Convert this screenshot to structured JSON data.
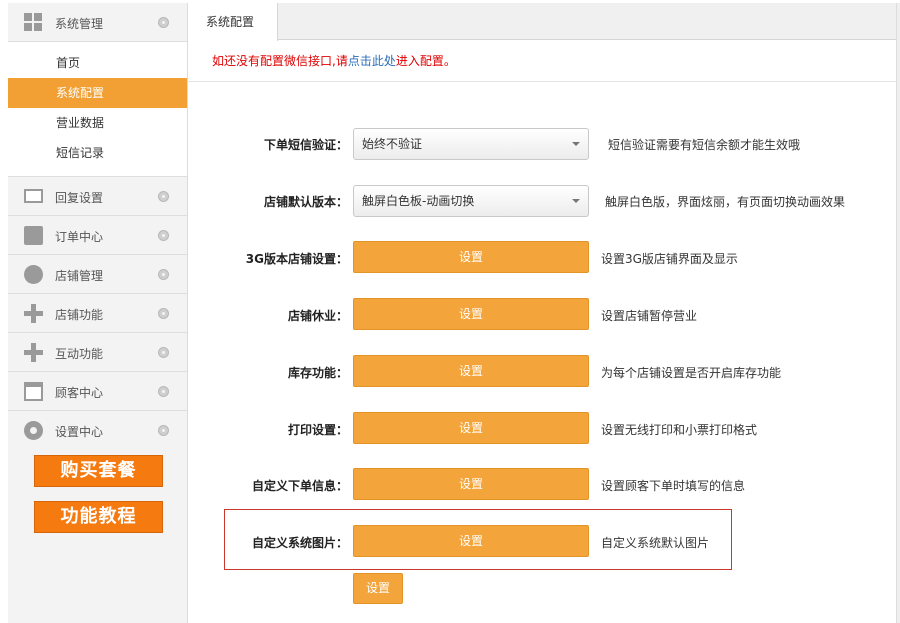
{
  "sidebar": {
    "groups": [
      {
        "label": "系统管理",
        "icon": "grid-icon"
      },
      {
        "label": "回复设置",
        "icon": "mail-icon"
      },
      {
        "label": "订单中心",
        "icon": "printer-icon"
      },
      {
        "label": "店铺管理",
        "icon": "pie-chart-icon"
      },
      {
        "label": "店铺功能",
        "icon": "plus-icon"
      },
      {
        "label": "互动功能",
        "icon": "plus-icon"
      },
      {
        "label": "顾客中心",
        "icon": "inbox-icon"
      },
      {
        "label": "设置中心",
        "icon": "gear-icon"
      }
    ],
    "sub_items": [
      {
        "label": "首页"
      },
      {
        "label": "系统配置"
      },
      {
        "label": "营业数据"
      },
      {
        "label": "短信记录"
      }
    ],
    "promo": {
      "buy_label": "购买套餐",
      "tutorial_label": "功能教程"
    }
  },
  "tabs": {
    "active_label": "系统配置"
  },
  "notice": {
    "part1": "如还没有配置微信接口,请",
    "link_text": "点击此处",
    "part2": "进入配置。"
  },
  "settings": {
    "sms_verify": {
      "label": "下单短信验证：",
      "value": "始终不验证",
      "desc": "短信验证需要有短信余额才能生效哦"
    },
    "default_version": {
      "label": "店铺默认版本：",
      "value": "触屏白色板-动画切换",
      "desc": "触屏白色版，界面炫丽，有页面切换动画效果"
    },
    "rows": [
      {
        "label": "3G版本店铺设置：",
        "button": "设置",
        "desc": "设置3G版店铺界面及显示"
      },
      {
        "label": "店铺休业：",
        "button": "设置",
        "desc": "设置店铺暂停营业"
      },
      {
        "label": "库存功能：",
        "button": "设置",
        "desc": "为每个店铺设置是否开启库存功能"
      },
      {
        "label": "打印设置：",
        "button": "设置",
        "desc": "设置无线打印和小票打印格式"
      },
      {
        "label": "自定义下单信息：",
        "button": "设置",
        "desc": "设置顾客下单时填写的信息"
      },
      {
        "label": "自定义系统图片：",
        "button": "设置",
        "desc": "自定义系统默认图片"
      }
    ],
    "extra_button": "设置"
  },
  "colors": {
    "accent": "#f3a43a",
    "active_item": "#f2a034",
    "promo": "#f57a10",
    "notice_red": "#e00000",
    "notice_link": "#2a6ebb",
    "highlight_border": "#c9372c"
  }
}
